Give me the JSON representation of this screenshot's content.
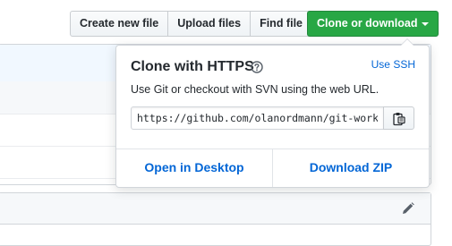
{
  "toolbar": {
    "create_new_file": "Create new file",
    "upload_files": "Upload files",
    "find_file": "Find file",
    "clone_or_download": "Clone or download"
  },
  "clone_panel": {
    "title": "Clone with HTTPS",
    "use_ssh": "Use SSH",
    "description": "Use Git or checkout with SVN using the web URL.",
    "url": "https://github.com/olanordmann/git-workshop.git",
    "open_in_desktop": "Open in Desktop",
    "download_zip": "Download ZIP"
  },
  "colors": {
    "primary_green": "#28a745",
    "link_blue": "#0366d6"
  },
  "icons": [
    "question-icon",
    "clipboard-icon",
    "pencil-icon",
    "caret-down-icon"
  ]
}
